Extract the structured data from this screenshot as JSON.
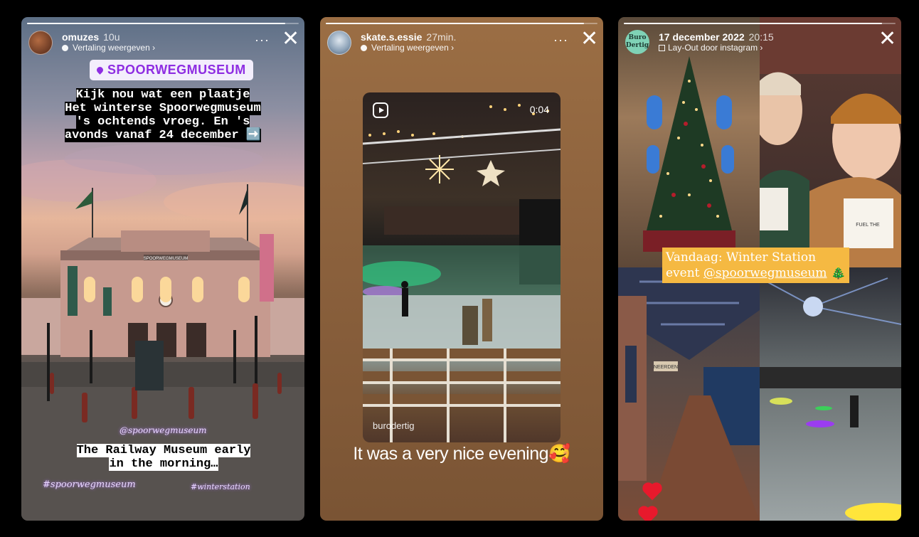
{
  "story1": {
    "username": "omuzes",
    "time": "10u",
    "translate": "Vertaling weergeven",
    "chevron": "›",
    "more": "···",
    "close": "✕",
    "location": "SPOORWEGMUSEUM",
    "caption_lines": [
      "Kijk nou wat een plaatje",
      "Het winterse Spoorwegmuseum",
      "'s ochtends vroeg. En 's",
      "avonds vanaf 24 december ➡️"
    ],
    "mention": "@spoorwegmuseum",
    "caption2_lines": [
      "The Railway Museum early",
      "in the morning…"
    ],
    "hashtag1": "#spoorwegmuseum",
    "hashtag2": "#winterstation",
    "building_sign": "SPOORWEGMUSEUM",
    "progress": 0.95
  },
  "story2": {
    "username": "skate.s.essie",
    "time": "27min.",
    "translate": "Vertaling weergeven",
    "chevron": "›",
    "more": "···",
    "close": "✕",
    "reel_duration": "0:04",
    "reel_author": "burodertig",
    "caption": "It was a very nice evening🥰",
    "progress": 0.95
  },
  "story3": {
    "logo_text": "Buro Dertig",
    "date": "17 december 2022",
    "time": "20:15",
    "layout_credit": "Lay-Out door instagram",
    "chevron": "›",
    "close": "✕",
    "caption_plain": "Vandaag: Winter Station",
    "caption_prefix": "event ",
    "caption_mention": "@spoorwegmuseum",
    "caption_emoji": " 🎄",
    "cup_text": "FUEL THE",
    "sign_text": "NEERDEN",
    "progress": 0.95
  },
  "colors": {
    "location_text": "#8e2de2",
    "yellow_caption": "#f5b942",
    "heart": "#e8192c"
  }
}
